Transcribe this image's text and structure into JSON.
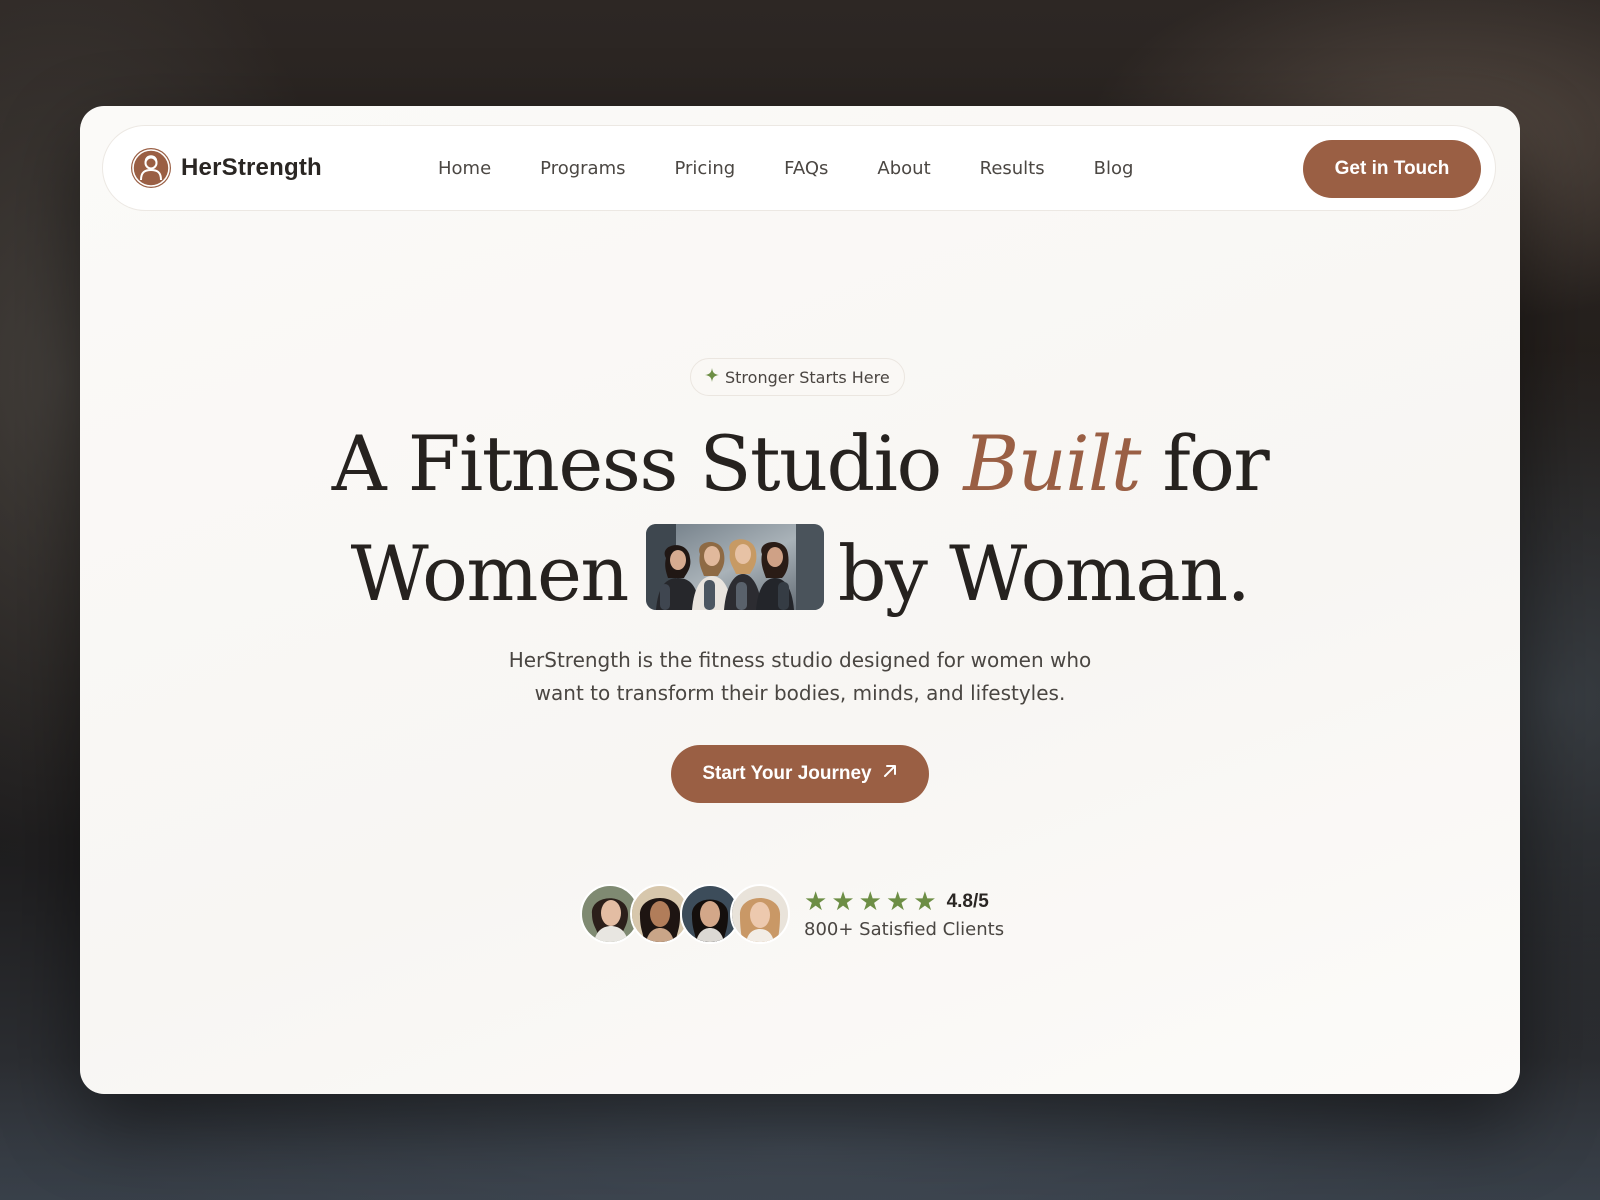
{
  "brand": {
    "name": "HerStrength",
    "logo_icon": "woman-silhouette-icon",
    "color": "#9a5f44"
  },
  "nav": {
    "links": [
      "Home",
      "Programs",
      "Pricing",
      "FAQs",
      "About",
      "Results",
      "Blog"
    ],
    "cta_label": "Get in Touch"
  },
  "hero": {
    "tagline": {
      "icon": "sparkle-icon",
      "text": "Stronger Starts Here"
    },
    "headline": {
      "line1_before": "A Fitness Studio ",
      "line1_accent": "Built",
      "line1_after": " for",
      "line2_before": "Women",
      "line2_after": "by Woman."
    },
    "inline_photo": "group-of-women-with-yoga-mats-photo",
    "subtext_line1": "HerStrength is the fitness studio designed for women who",
    "subtext_line2": "want to transform their bodies, minds, and lifestyles.",
    "cta_label": "Start Your Journey",
    "cta_icon": "arrow-up-right-icon"
  },
  "social_proof": {
    "avatars": [
      "client-avatar-1",
      "client-avatar-2",
      "client-avatar-3",
      "client-avatar-4"
    ],
    "stars": 5,
    "rating": "4.8/5",
    "clients_text": "800+ Satisfied Clients"
  },
  "colors": {
    "accent": "#9a5f44",
    "star": "#6d8e45",
    "text": "#26221f",
    "card_bg": "#f9f7f4"
  }
}
